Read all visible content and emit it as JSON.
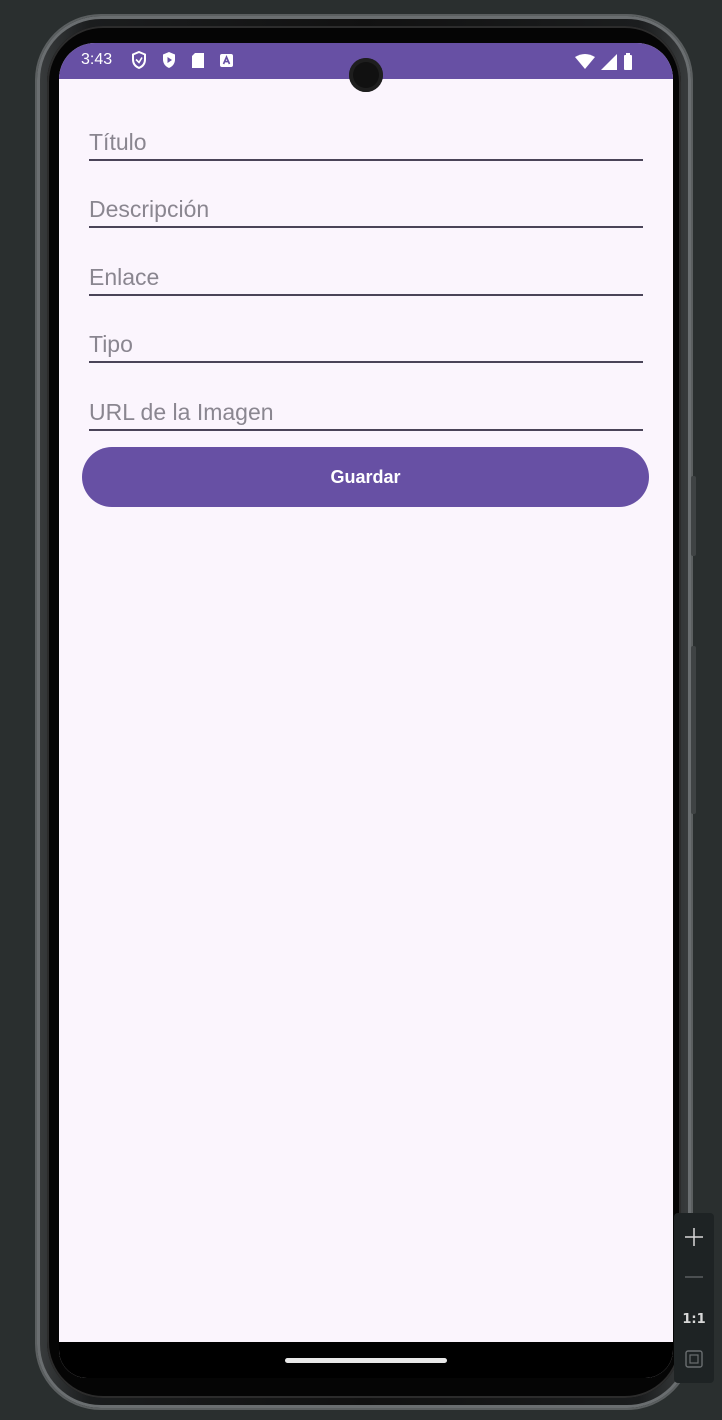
{
  "status_bar": {
    "time": "3:43",
    "left_icons": [
      "vpn-shield-icon",
      "play-protect-icon",
      "sd-card-icon",
      "app-notification-icon"
    ],
    "right_icons": [
      "wifi-icon",
      "cellular-signal-icon",
      "battery-icon"
    ],
    "background_color": "#6750a4"
  },
  "form": {
    "fields": [
      {
        "placeholder": "Título",
        "value": ""
      },
      {
        "placeholder": "Descripción",
        "value": ""
      },
      {
        "placeholder": "Enlace",
        "value": ""
      },
      {
        "placeholder": "Tipo",
        "value": ""
      },
      {
        "placeholder": "URL de la Imagen",
        "value": ""
      }
    ],
    "save_button": {
      "label": "Guardar",
      "color": "#6750a4"
    }
  },
  "emulator_controls": {
    "zoom_in_icon": "plus-icon",
    "zoom_out_icon": "minus-icon",
    "actual_size_label": "1:1",
    "fit_screen_icon": "fit-screen-icon"
  },
  "colors": {
    "screen_background": "#fbf5fd",
    "primary": "#6750a4",
    "field_underline": "#4a4458",
    "placeholder": "#8a8690"
  }
}
